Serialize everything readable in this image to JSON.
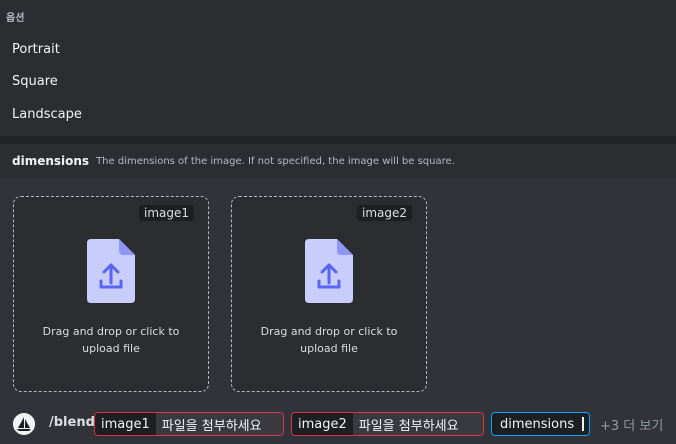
{
  "options": {
    "header": "옵션",
    "items": [
      "Portrait",
      "Square",
      "Landscape"
    ]
  },
  "description": {
    "name": "dimensions",
    "text": "The dimensions of the image. If not specified, the image will be square."
  },
  "uploads": [
    {
      "tag": "image1",
      "text": "Drag and drop or click to upload file",
      "icon": "upload-file-icon"
    },
    {
      "tag": "image2",
      "text": "Drag and drop or click to upload file",
      "icon": "upload-file-icon"
    }
  ],
  "command": {
    "name": "/blend",
    "params": [
      {
        "key": "image1",
        "value": "파일을 첨부하세요"
      },
      {
        "key": "image2",
        "value": "파일을 첨부하세요"
      }
    ],
    "active_param": "dimensions",
    "more": "+3 더 보기"
  },
  "colors": {
    "background": "#313338",
    "panel": "#2b2d31",
    "error_border": "#da373c",
    "focus_border": "#00a8fc",
    "icon_fill": "#c9cdfb",
    "icon_accent": "#5865f2"
  }
}
